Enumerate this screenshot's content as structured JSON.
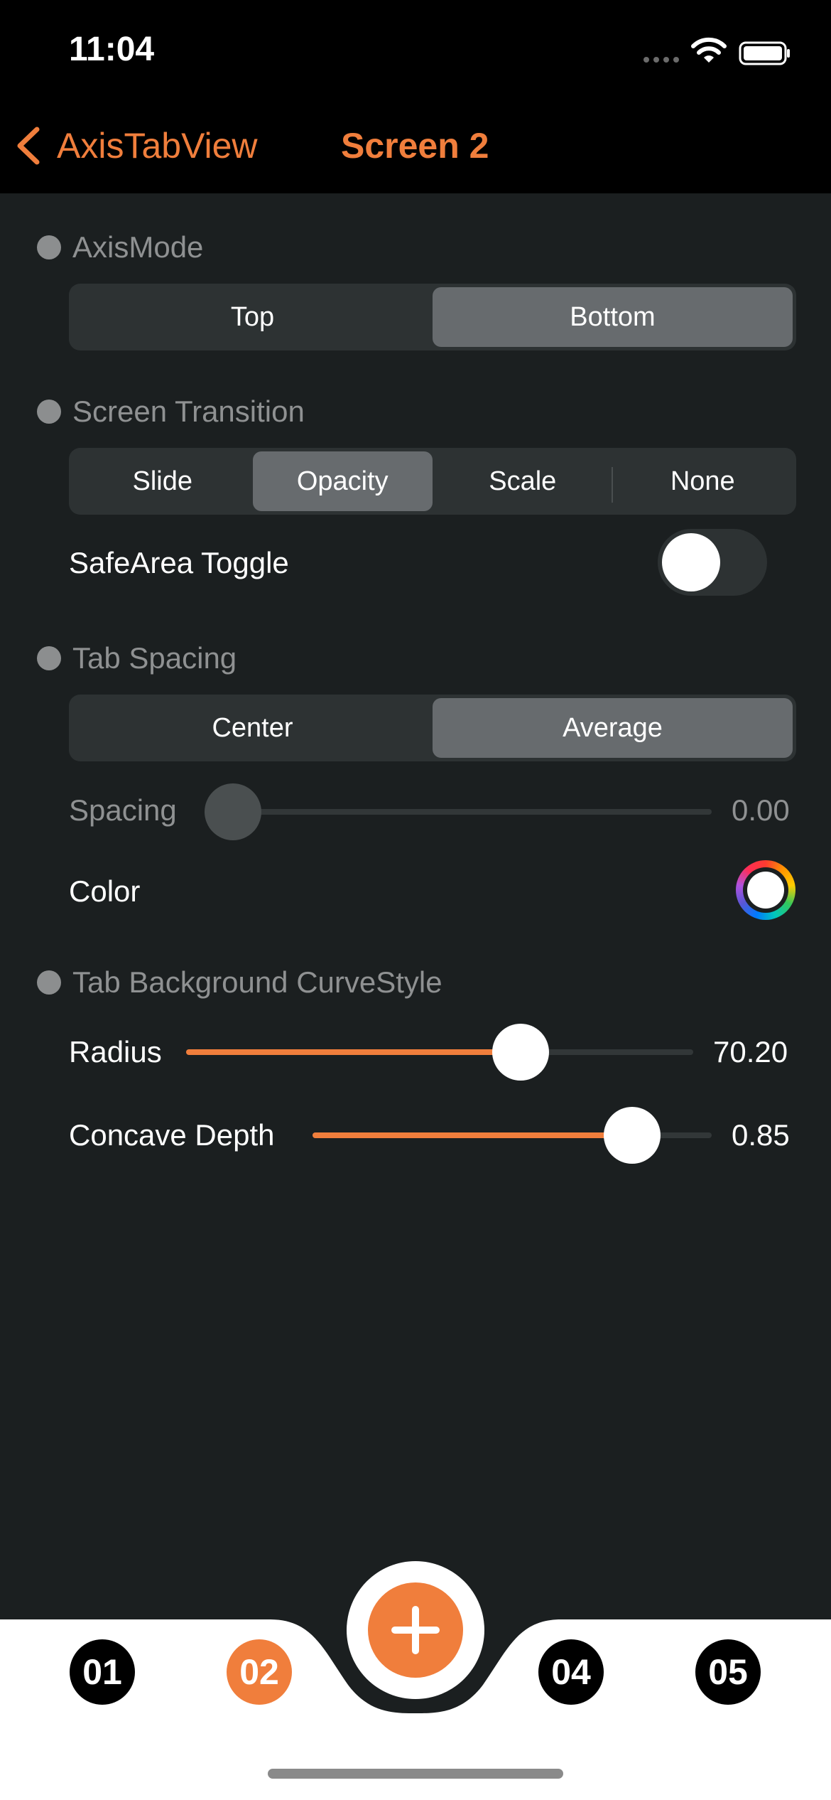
{
  "status": {
    "time": "11:04"
  },
  "nav": {
    "back_label": "AxisTabView",
    "title": "Screen 2"
  },
  "axis_mode": {
    "label": "AxisMode",
    "options": [
      "Top",
      "Bottom"
    ],
    "selected": "Bottom"
  },
  "screen_transition": {
    "label": "Screen Transition",
    "options": [
      "Slide",
      "Opacity",
      "Scale",
      "None"
    ],
    "selected": "Opacity"
  },
  "safe_area": {
    "label": "SafeArea Toggle",
    "on": false
  },
  "tab_spacing": {
    "label": "Tab Spacing",
    "options": [
      "Center",
      "Average"
    ],
    "selected": "Average"
  },
  "spacing": {
    "label": "Spacing",
    "value": "0.00",
    "fraction": 0.0,
    "enabled": false
  },
  "color": {
    "label": "Color"
  },
  "curve_style": {
    "label": "Tab Background CurveStyle"
  },
  "radius": {
    "label": "Radius",
    "value": "70.20",
    "fraction": 0.68
  },
  "concave_depth": {
    "label": "Concave Depth",
    "value": "0.85",
    "fraction": 0.85
  },
  "tabs": [
    {
      "label": "01"
    },
    {
      "label": "02"
    },
    {
      "label": "04"
    },
    {
      "label": "05"
    }
  ],
  "selected_tab": "02",
  "colors": {
    "accent": "#f07e3c",
    "background": "#1b1f20",
    "control": "#2d3233",
    "selected_segment": "#676b6e"
  }
}
